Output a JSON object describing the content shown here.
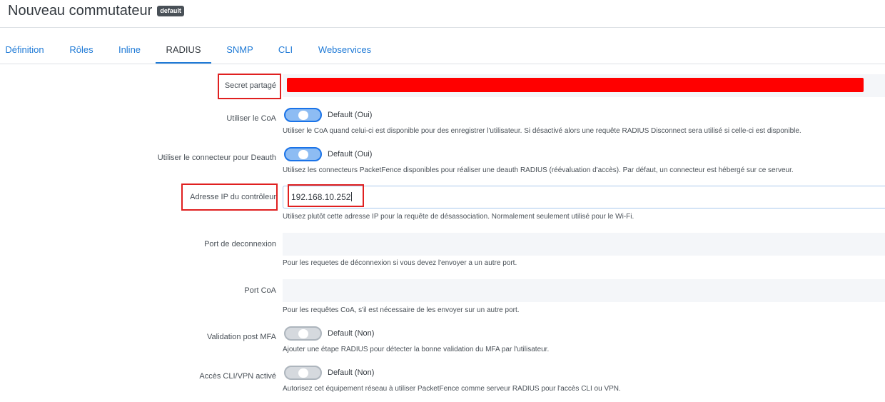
{
  "header": {
    "title": "Nouveau commutateur",
    "badge": "default"
  },
  "tabs": [
    {
      "label": "Définition"
    },
    {
      "label": "Rôles"
    },
    {
      "label": "Inline"
    },
    {
      "label": "RADIUS",
      "active": true
    },
    {
      "label": "SNMP"
    },
    {
      "label": "CLI"
    },
    {
      "label": "Webservices"
    }
  ],
  "form": {
    "secret": {
      "label": "Secret partagé"
    },
    "coa": {
      "label": "Utiliser le CoA",
      "state": "Default (Oui)",
      "help": "Utiliser le CoA quand celui-ci est disponible pour des enregistrer l'utilisateur. Si désactivé alors une requête RADIUS Disconnect sera utilisé si celle-ci est disponible."
    },
    "deauth": {
      "label": "Utiliser le connecteur pour Deauth",
      "state": "Default (Oui)",
      "help": "Utilisez les connecteurs PacketFence disponibles pour réaliser une deauth RADIUS (réévaluation d'accès). Par défaut, un connecteur est hébergé sur ce serveur."
    },
    "controller_ip": {
      "label": "Adresse IP du contrôleur",
      "value": "192.168.10.252",
      "help": "Utilisez plutôt cette adresse IP pour la requête de désassociation. Normalement seulement utilisé pour le Wi-Fi."
    },
    "disconnect_port": {
      "label": "Port de deconnexion",
      "help": "Pour les requetes de déconnexion si vous devez l'envoyer a un autre port."
    },
    "coa_port": {
      "label": "Port CoA",
      "help": "Pour les requêtes CoA, s'il est nécessaire de les envoyer sur un autre port."
    },
    "mfa": {
      "label": "Validation post MFA",
      "state": "Default (Non)",
      "help": "Ajouter une étape RADIUS pour détecter la bonne validation du MFA par l'utilisateur."
    },
    "cli_vpn": {
      "label": "Accès CLI/VPN activé",
      "state": "Default (Non)",
      "help": "Autorisez cet équipement réseau à utiliser PacketFence comme serveur RADIUS pour l'accès CLI ou VPN."
    }
  },
  "colors": {
    "accent": "#1f7ad6",
    "annotation": "#e02020",
    "redaction": "#ff0000"
  }
}
